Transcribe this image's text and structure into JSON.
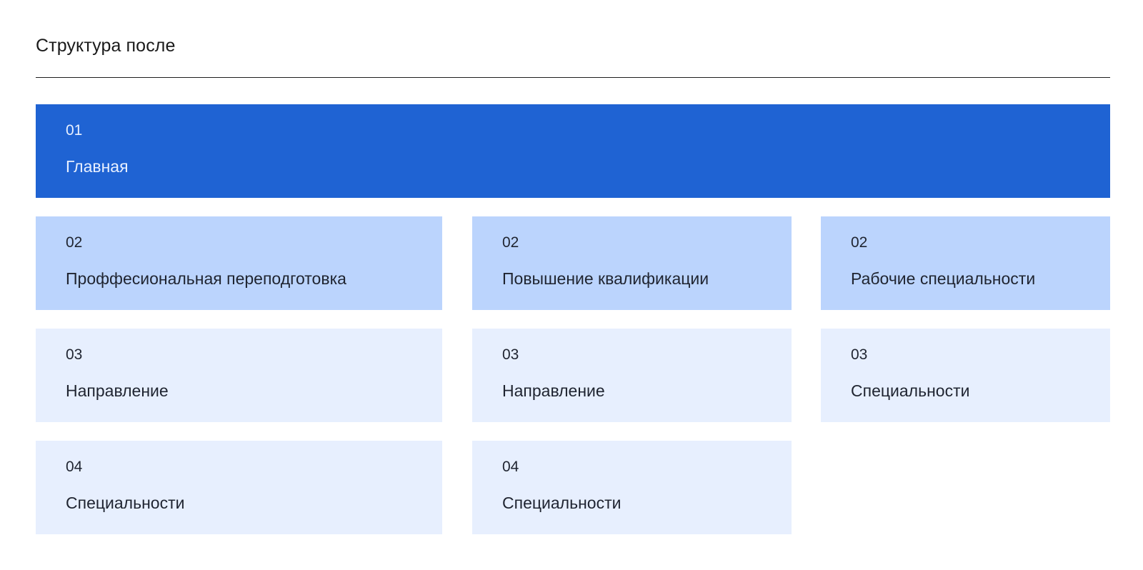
{
  "title": "Структура после",
  "colors": {
    "level1": "#1f63d3",
    "level2": "#bbd4fd",
    "level3": "#e7effe"
  },
  "nodes": {
    "main": {
      "num": "01",
      "label": "Главная"
    },
    "l2": [
      {
        "num": "02",
        "label": "Проффесиональная переподготовка"
      },
      {
        "num": "02",
        "label": "Повышение квалификации"
      },
      {
        "num": "02",
        "label": "Рабочие специальности"
      }
    ],
    "l3": [
      {
        "num": "03",
        "label": "Направление"
      },
      {
        "num": "03",
        "label": "Направление"
      },
      {
        "num": "03",
        "label": "Специальности"
      }
    ],
    "l4": [
      {
        "num": "04",
        "label": "Специальности"
      },
      {
        "num": "04",
        "label": "Специальности"
      }
    ]
  }
}
